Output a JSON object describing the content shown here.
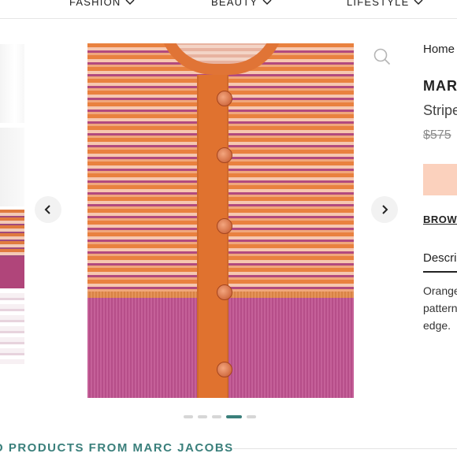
{
  "nav": {
    "items": [
      "FASHION",
      "BEAUTY",
      "LIFESTYLE"
    ]
  },
  "product": {
    "breadcrumb": "Home",
    "brand": "MARC",
    "name": "Stripe",
    "price": "$575",
    "browse_link": "BROWSE",
    "description_tab": "Descrip",
    "description_lines": [
      "Orange",
      "patterne",
      "edge."
    ]
  },
  "gallery": {
    "image_count": 5,
    "active_index": 3
  },
  "related": {
    "heading": "O PRODUCTS FROM MARC JACOBS"
  },
  "colors": {
    "accent": "#3a7f7b",
    "cta": "#fbd1bd",
    "knit_orange": "#e0722f",
    "knit_purple": "#b24a7e"
  },
  "icons": [
    "chevron-down-icon",
    "search-icon",
    "chevron-left-icon",
    "chevron-right-icon"
  ]
}
